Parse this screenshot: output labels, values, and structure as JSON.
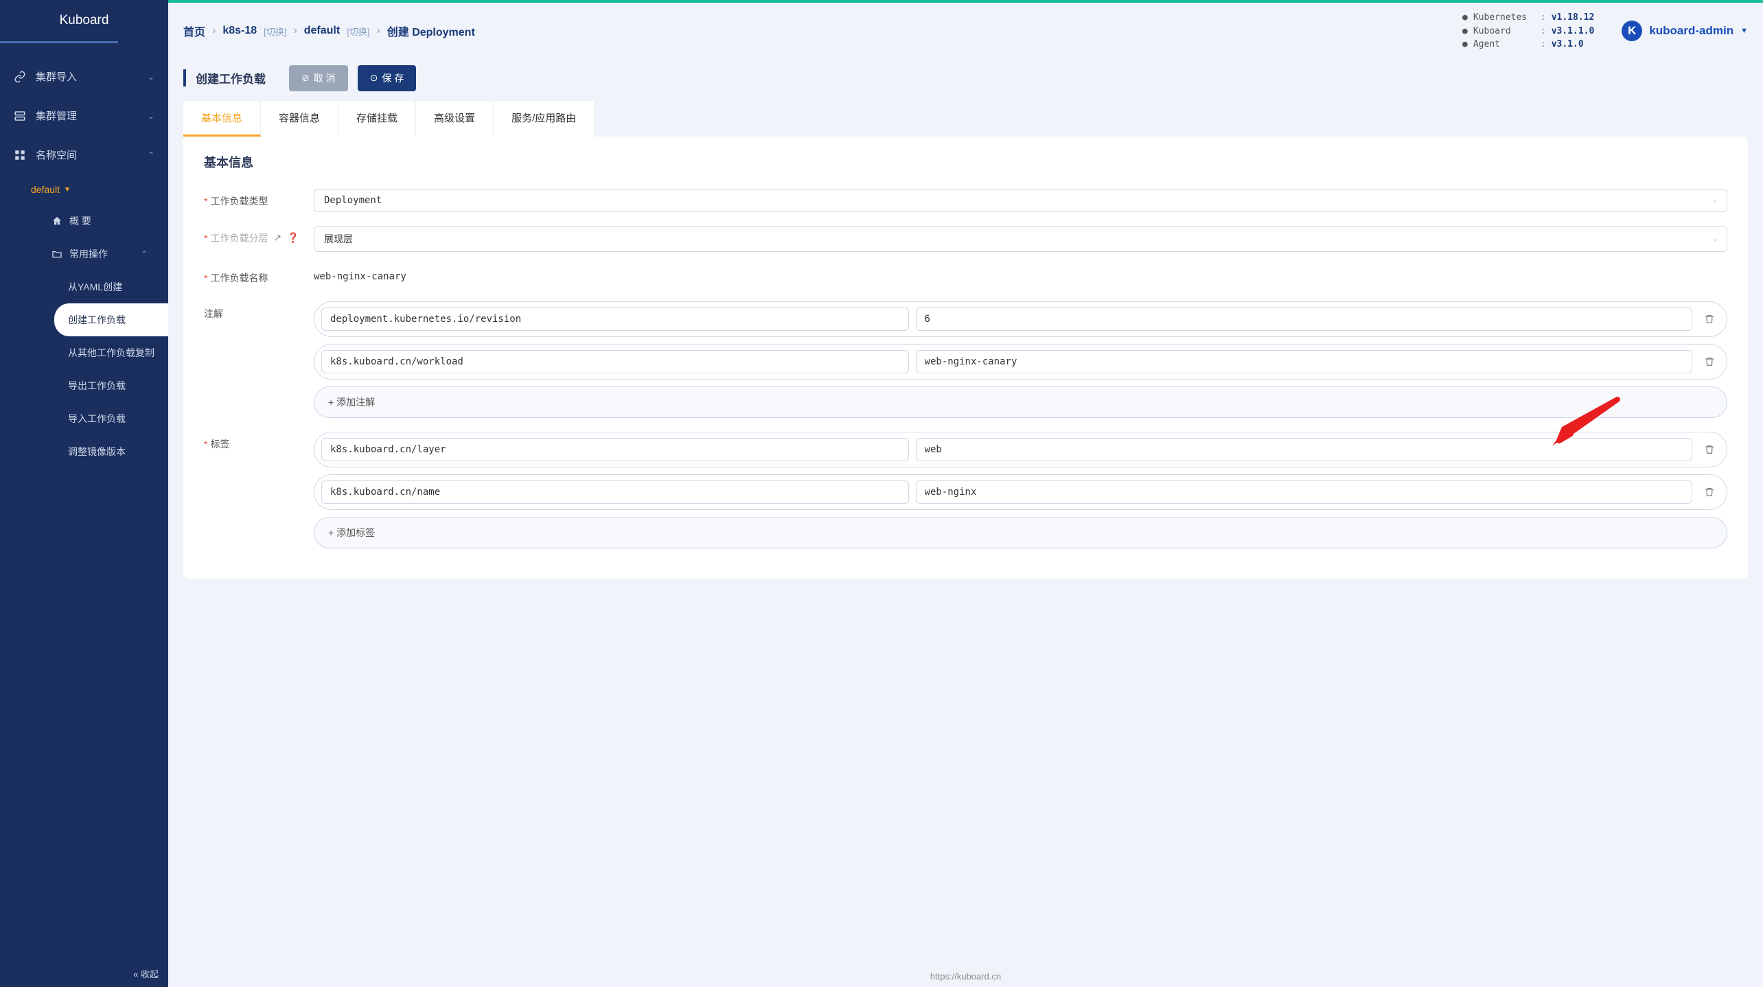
{
  "brand": "Kuboard",
  "sidebar": {
    "items": [
      {
        "label": "集群导入",
        "icon": "link-icon"
      },
      {
        "label": "集群管理",
        "icon": "layers-icon"
      },
      {
        "label": "名称空间",
        "icon": "grid-icon"
      }
    ],
    "ns_selected": "default",
    "sub_overview": "概 要",
    "sub_common_ops": "常用操作",
    "deep_items": [
      "从YAML创建",
      "创建工作负载",
      "从其他工作负载复制",
      "导出工作负载",
      "导入工作负载",
      "调整镜像版本"
    ],
    "collapse": "« 收起"
  },
  "breadcrumb": {
    "home": "首页",
    "cluster": "k8s-18",
    "switch": "[切换]",
    "ns": "default",
    "page": "创建 Deployment"
  },
  "versions": [
    {
      "label": "Kubernetes",
      "val": "v1.18.12"
    },
    {
      "label": "Kuboard",
      "val": "v3.1.1.0"
    },
    {
      "label": "Agent",
      "val": "v3.1.0"
    }
  ],
  "user": {
    "initial": "K",
    "name": "kuboard-admin"
  },
  "toolbar": {
    "title": "创建工作负载",
    "cancel": "取 消",
    "save": "保 存"
  },
  "tabs": [
    "基本信息",
    "容器信息",
    "存储挂载",
    "高级设置",
    "服务/应用路由"
  ],
  "panel": {
    "title": "基本信息",
    "labels": {
      "type": "工作负载类型",
      "layer": "工作负载分层",
      "name": "工作负载名称",
      "anno": "注解",
      "tags": "标签"
    },
    "type_value": "Deployment",
    "layer_value": "展现层",
    "name_value": "web-nginx-canary",
    "annotations": [
      {
        "k": "deployment.kubernetes.io/revision",
        "v": "6"
      },
      {
        "k": "k8s.kuboard.cn/workload",
        "v": "web-nginx-canary"
      }
    ],
    "add_anno": "+  添加注解",
    "tags_list": [
      {
        "k": "k8s.kuboard.cn/layer",
        "v": "web"
      },
      {
        "k": "k8s.kuboard.cn/name",
        "v": "web-nginx"
      }
    ],
    "add_tag": "+  添加标签"
  },
  "footer_url": "https://kuboard.cn"
}
